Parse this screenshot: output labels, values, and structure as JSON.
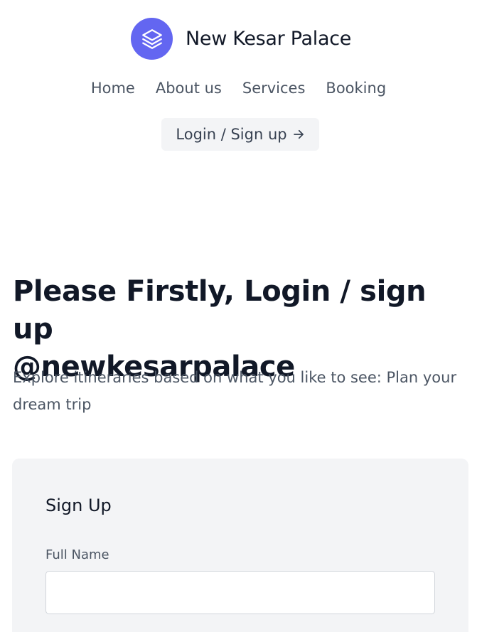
{
  "header": {
    "brand_name": "New Kesar Palace",
    "logo_icon": "stacked-layers-icon",
    "accent_color": "#6366f1"
  },
  "nav": {
    "items": [
      {
        "label": "Home"
      },
      {
        "label": "About us"
      },
      {
        "label": "Services"
      },
      {
        "label": "Booking"
      }
    ]
  },
  "login_button": {
    "label": "Login / Sign up",
    "icon": "arrow-right-icon"
  },
  "hero": {
    "title_line1": "Please Firstly, Login / sign up",
    "title_line2": "@newkesarpalace",
    "subtitle": "Explore itineraries based on what you like to see: Plan your dream trip"
  },
  "signup_form": {
    "title": "Sign Up",
    "full_name_label": "Full Name",
    "full_name_value": ""
  }
}
